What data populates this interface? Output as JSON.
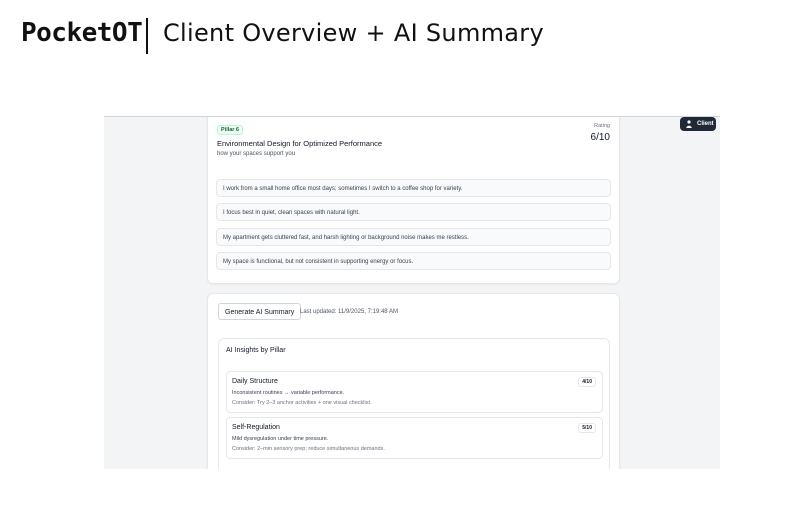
{
  "header": {
    "brand": "PocketOT",
    "title": "Client Overview + AI Summary"
  },
  "client_button": {
    "label": "Client",
    "icon": "person-icon"
  },
  "pillar": {
    "tag": "Pillar 6",
    "title": "Environmental Design for Optimized Performance",
    "subtitle": "how your spaces support you",
    "rating_label": "Rating",
    "rating_value": "6/10",
    "answers": [
      "I work from a small home office most days; sometimes I switch to a coffee shop for variety.",
      "I focus best in quiet, clean spaces with natural light.",
      "My apartment gets cluttered fast, and harsh lighting or background noise makes me restless.",
      "My space is functional, but not consistent in supporting energy or focus."
    ]
  },
  "summary": {
    "generate_label": "Generate AI Summary",
    "last_updated": "Last updated: 11/9/2025, 7:19:48 AM",
    "insights_title": "AI Insights by Pillar",
    "insights": [
      {
        "name": "Daily Structure",
        "score": "4/10",
        "text": "Inconsistent routines → variable performance.",
        "consider": "Consider: Try 2–3 anchor activities + one visual checklist."
      },
      {
        "name": "Self-Regulation",
        "score": "5/10",
        "text": "Mild dysregulation under time pressure.",
        "consider": "Consider: 2–min sensory prep; reduce simultaneous demands."
      }
    ]
  },
  "colors": {
    "frame_bg": "#f3f4f6",
    "client_button_bg": "#1f2937",
    "pillar_tag_bg": "#ecfdf5",
    "pillar_tag_text": "#166534"
  }
}
